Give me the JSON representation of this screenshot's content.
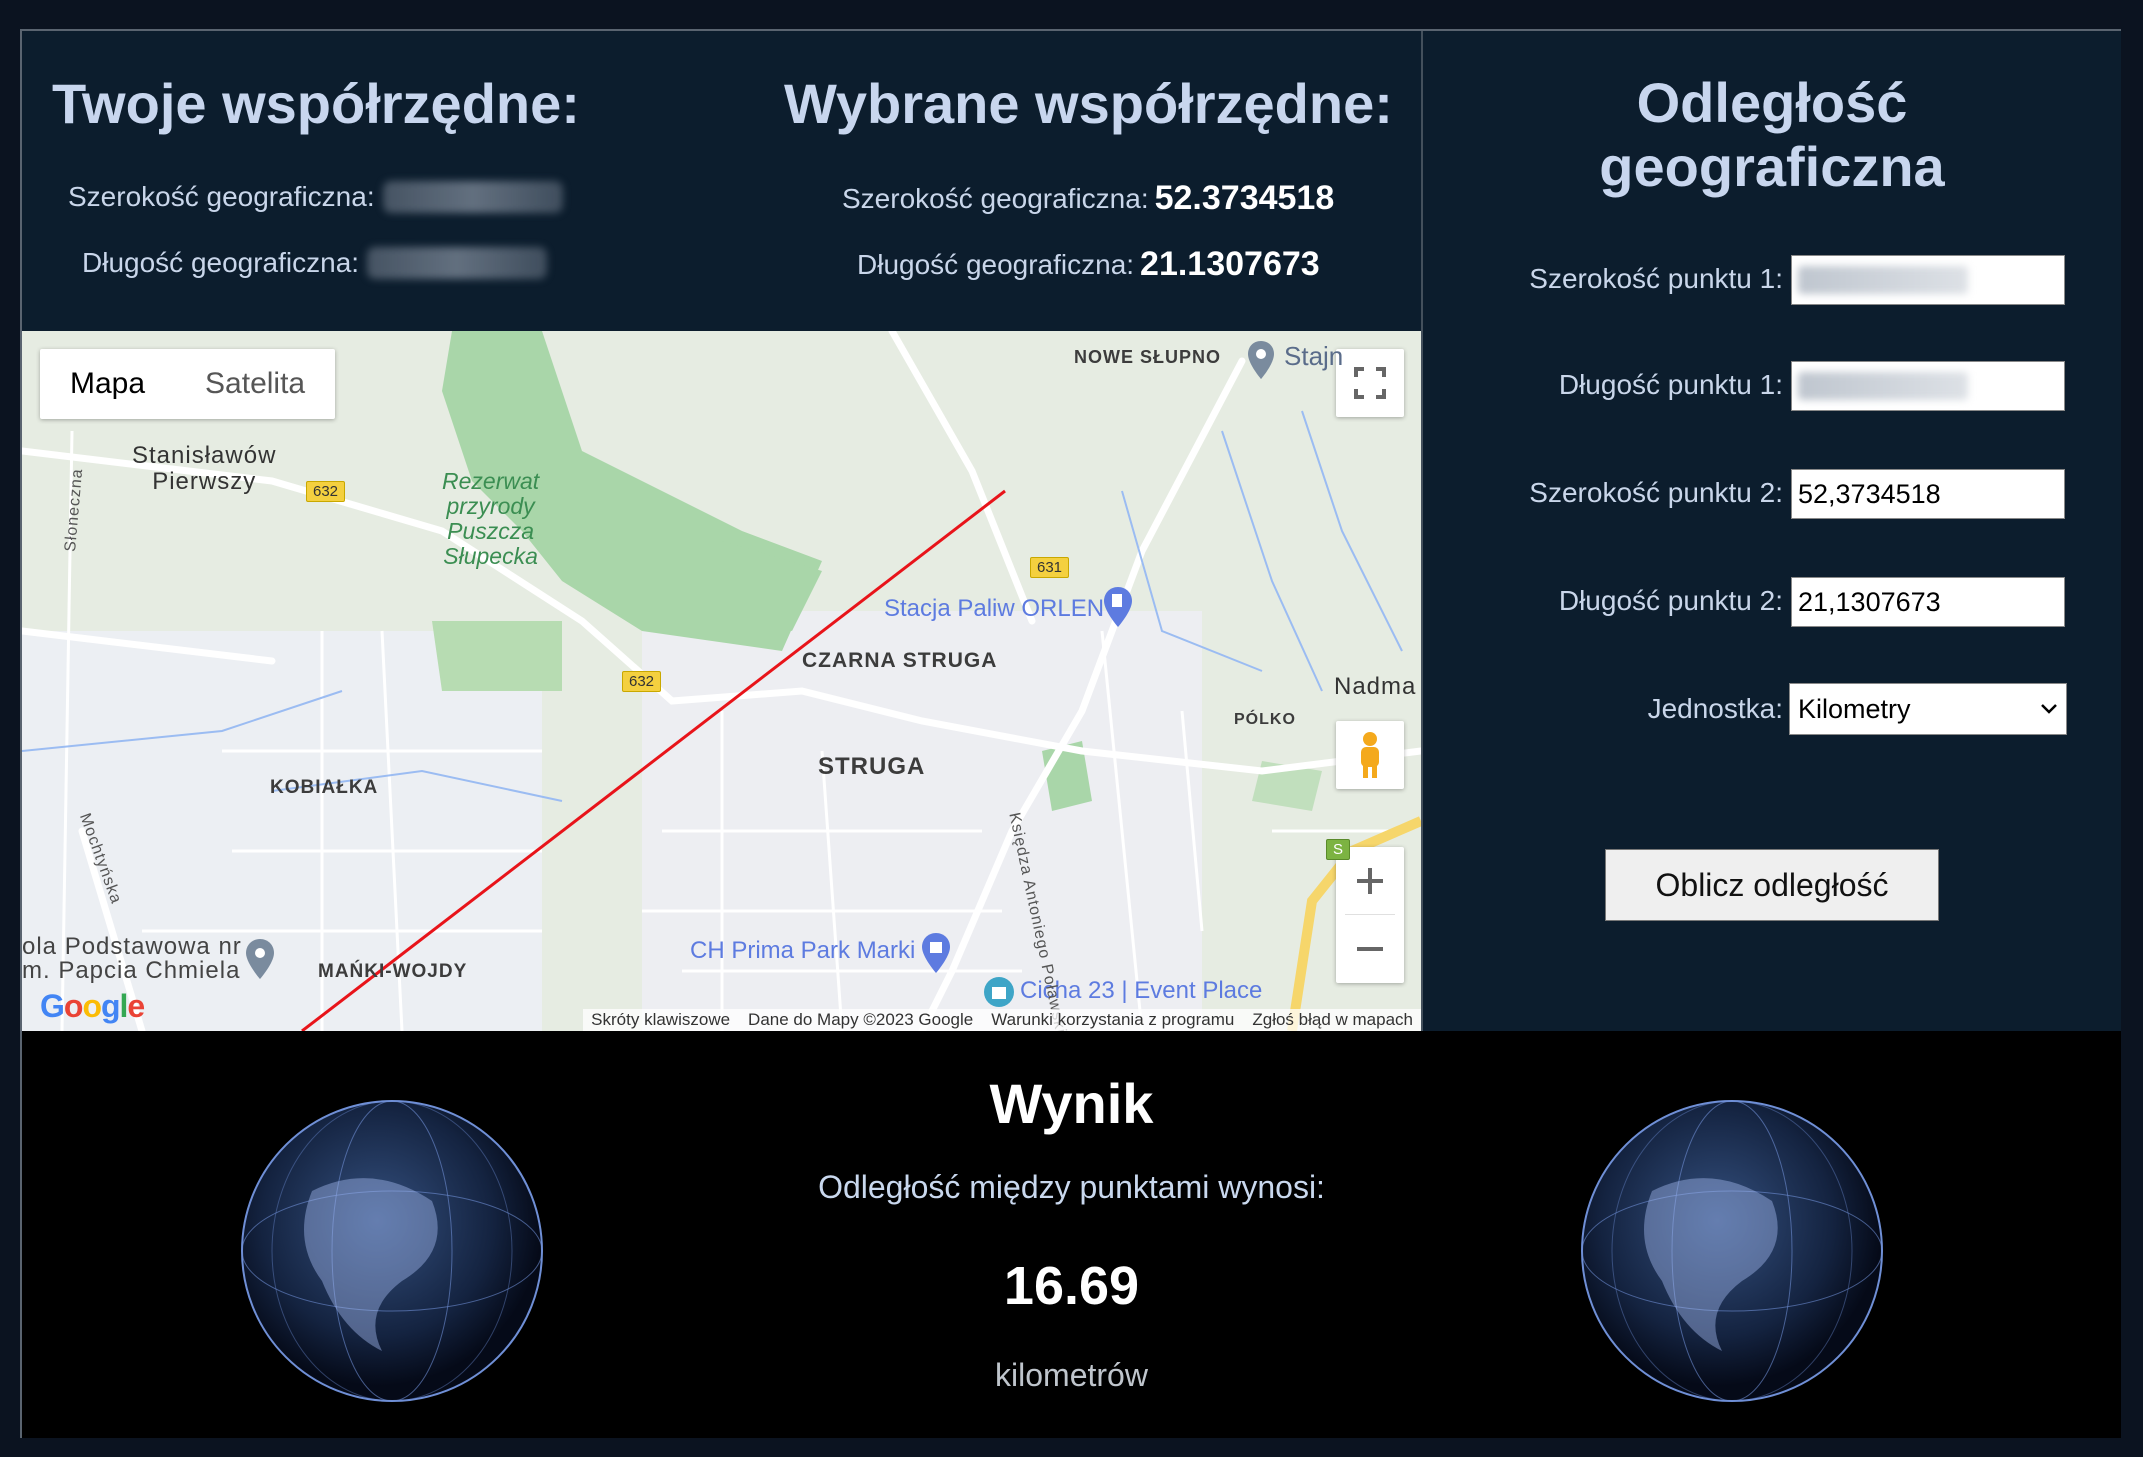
{
  "your_coords": {
    "title": "Twoje współrzędne:",
    "lat_label": "Szerokość geograficzna:",
    "lng_label": "Długość geograficzna:"
  },
  "selected_coords": {
    "title": "Wybrane współrzędne:",
    "lat_label": "Szerokość geograficzna:",
    "lat_value": "52.3734518",
    "lng_label": "Długość geograficzna:",
    "lng_value": "21.1307673"
  },
  "calculator": {
    "title_line1": "Odległość",
    "title_line2": "geograficzna",
    "p1_lat_label": "Szerokość punktu 1:",
    "p1_lng_label": "Długość punktu 1:",
    "p2_lat_label": "Szerokość punktu 2:",
    "p2_lat_value": "52,3734518",
    "p2_lng_label": "Długość punktu 2:",
    "p2_lng_value": "21,1307673",
    "unit_label": "Jednostka:",
    "unit_value": "Kilometry",
    "button": "Oblicz odległość"
  },
  "map": {
    "type_map": "Mapa",
    "type_satellite": "Satelita",
    "labels": {
      "stanislawow": "Stanisławów\nPierwszy",
      "rezerwat": "Rezerwat\nprzyrody\nPuszcza\nSłupecka",
      "nowe_slupno": "NOWE SŁUPNO",
      "stajnia": "Stajn",
      "czarna_struga": "CZARNA STRUGA",
      "struga": "STRUGA",
      "kobialka": "KOBIAŁKA",
      "nadma": "Nadma",
      "polko": "PÓLKO",
      "manki": "MAŃKI-WOJDY",
      "orlen": "Stacja Paliw ORLEN",
      "prima": "CH Prima Park Marki",
      "cicha": "Cicha 23 | Event Place",
      "szkola": "ola Podstawowa nr\nm. Papcia Chmiela",
      "polawskiego": "Księdza Antoniego Poławskiego",
      "mochtynska": "Mochtyńska",
      "sloneczna": "Słoneczna",
      "road_632a": "632",
      "road_632b": "632",
      "road_631": "631",
      "road_s": "S"
    },
    "attribution": {
      "shortcuts": "Skróty klawiszowe",
      "data": "Dane do Mapy ©2023 Google",
      "terms": "Warunki korzystania z programu",
      "report": "Zgłoś błąd w mapach"
    },
    "logo": "Google"
  },
  "result": {
    "title": "Wynik",
    "description": "Odległość między punktami wynosi:",
    "value": "16.69",
    "unit": "kilometrów"
  },
  "colors": {
    "panel_bg": "#0c1d2d",
    "heading": "#c8d6ee",
    "result_bg": "#000000",
    "route_line": "#e8141a"
  }
}
